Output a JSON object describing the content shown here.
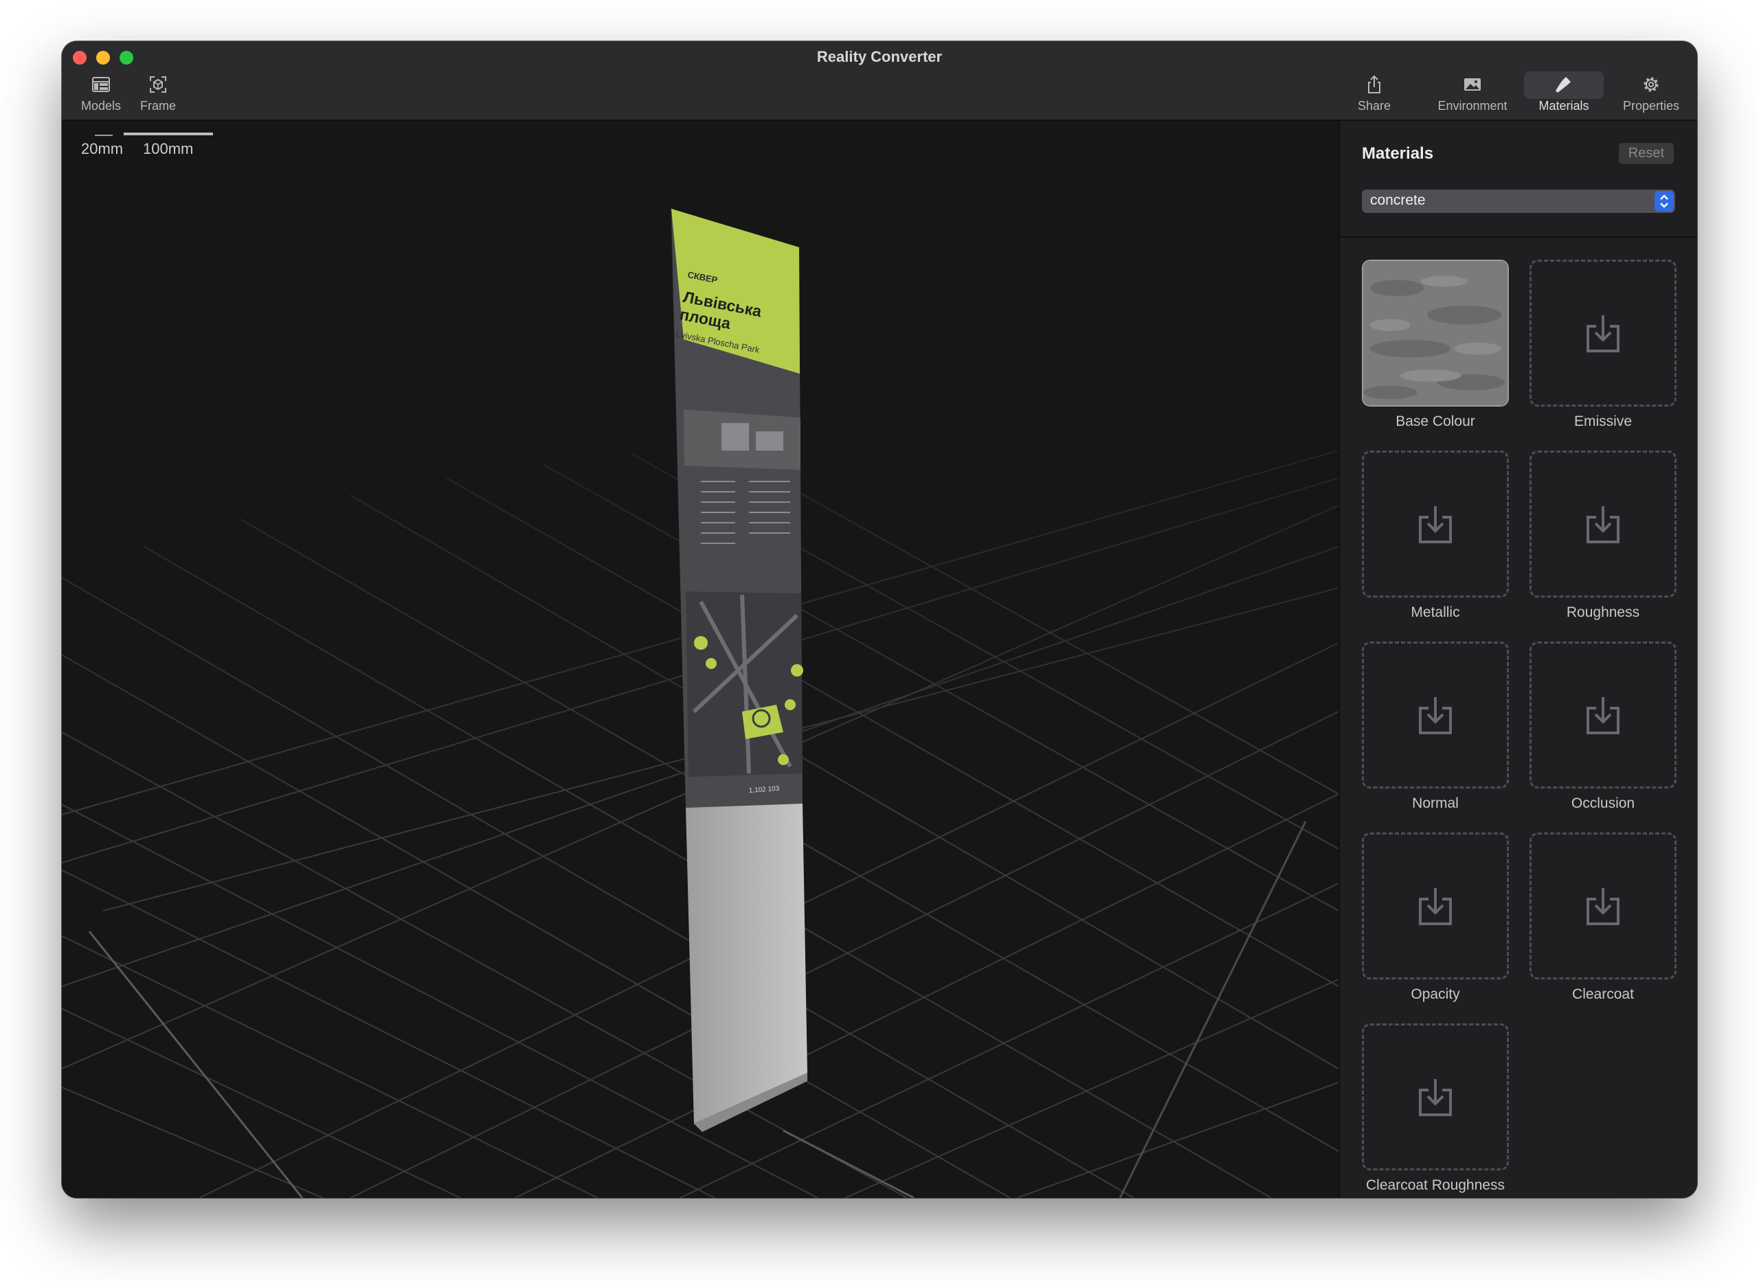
{
  "window": {
    "title": "Reality Converter"
  },
  "toolbar": {
    "left": [
      {
        "label": "Models",
        "icon": "models-icon"
      },
      {
        "label": "Frame",
        "icon": "frame-icon"
      }
    ],
    "right": [
      {
        "label": "Share",
        "icon": "share-icon"
      },
      {
        "label": "Environment",
        "icon": "environment-icon"
      },
      {
        "label": "Materials",
        "icon": "materials-icon",
        "active": true
      },
      {
        "label": "Properties",
        "icon": "gear-icon"
      }
    ]
  },
  "viewport": {
    "scale": {
      "small": "20mm",
      "large": "100mm"
    },
    "sign": {
      "kicker": "СКВЕР",
      "title_line1": "Львівська",
      "title_line2": "площа",
      "subtitle": "Lvivska Ploscha Park",
      "stats": "1,102  103"
    }
  },
  "materials_panel": {
    "title": "Materials",
    "reset_label": "Reset",
    "selected_material": "concrete",
    "slots": [
      {
        "label": "Base Colour",
        "filled": true
      },
      {
        "label": "Emissive",
        "filled": false
      },
      {
        "label": "Metallic",
        "filled": false
      },
      {
        "label": "Roughness",
        "filled": false
      },
      {
        "label": "Normal",
        "filled": false
      },
      {
        "label": "Occlusion",
        "filled": false
      },
      {
        "label": "Opacity",
        "filled": false
      },
      {
        "label": "Clearcoat",
        "filled": false
      },
      {
        "label": "Clearcoat Roughness",
        "filled": false
      }
    ]
  },
  "colors": {
    "accent": "#2f6be6",
    "sign_green": "#b5cd4c",
    "panel_bg": "#1f1e21",
    "viewport_bg": "#161616"
  }
}
